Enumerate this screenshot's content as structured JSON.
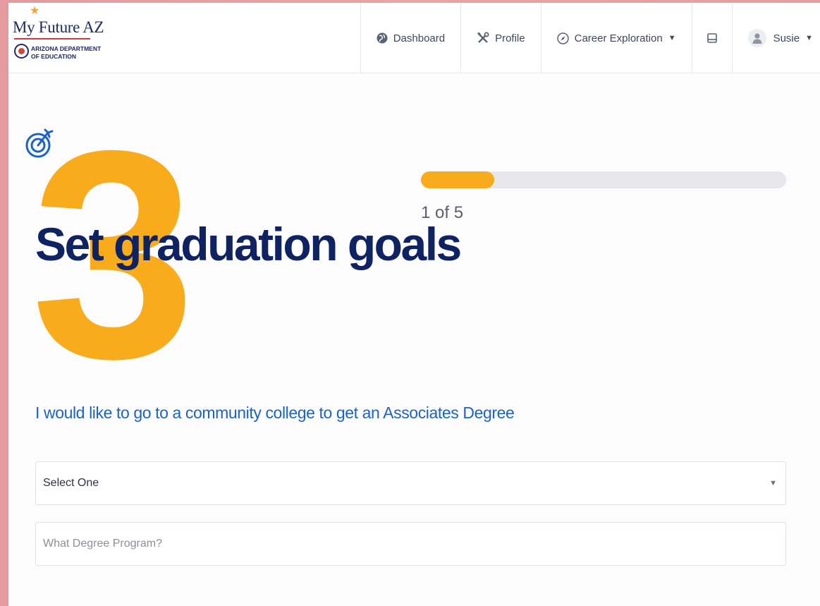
{
  "brand": {
    "title": "My Future AZ",
    "dept_line1": "ARIZONA DEPARTMENT",
    "dept_line2": "OF EDUCATION"
  },
  "nav": {
    "items": [
      {
        "label": "Dashboard",
        "icon": "globe-icon"
      },
      {
        "label": "Profile",
        "icon": "tools-icon"
      },
      {
        "label": "Career Exploration",
        "icon": "compass-icon"
      },
      {
        "label": "",
        "icon": "inbox-icon"
      }
    ],
    "user": {
      "name": "Susie",
      "icon": "user-icon"
    }
  },
  "step": {
    "number": "3",
    "title": "Set graduation goals"
  },
  "progress": {
    "label": "1 of 5",
    "fraction": 0.2
  },
  "goal": {
    "text": "I would like to go to a community college to get an Associates Degree"
  },
  "form": {
    "select_value": "Select One",
    "degree_placeholder": "What Degree Program?"
  },
  "colors": {
    "accent": "#f8ac1b",
    "title": "#0f2262",
    "link_blue": "#1b63c7"
  }
}
